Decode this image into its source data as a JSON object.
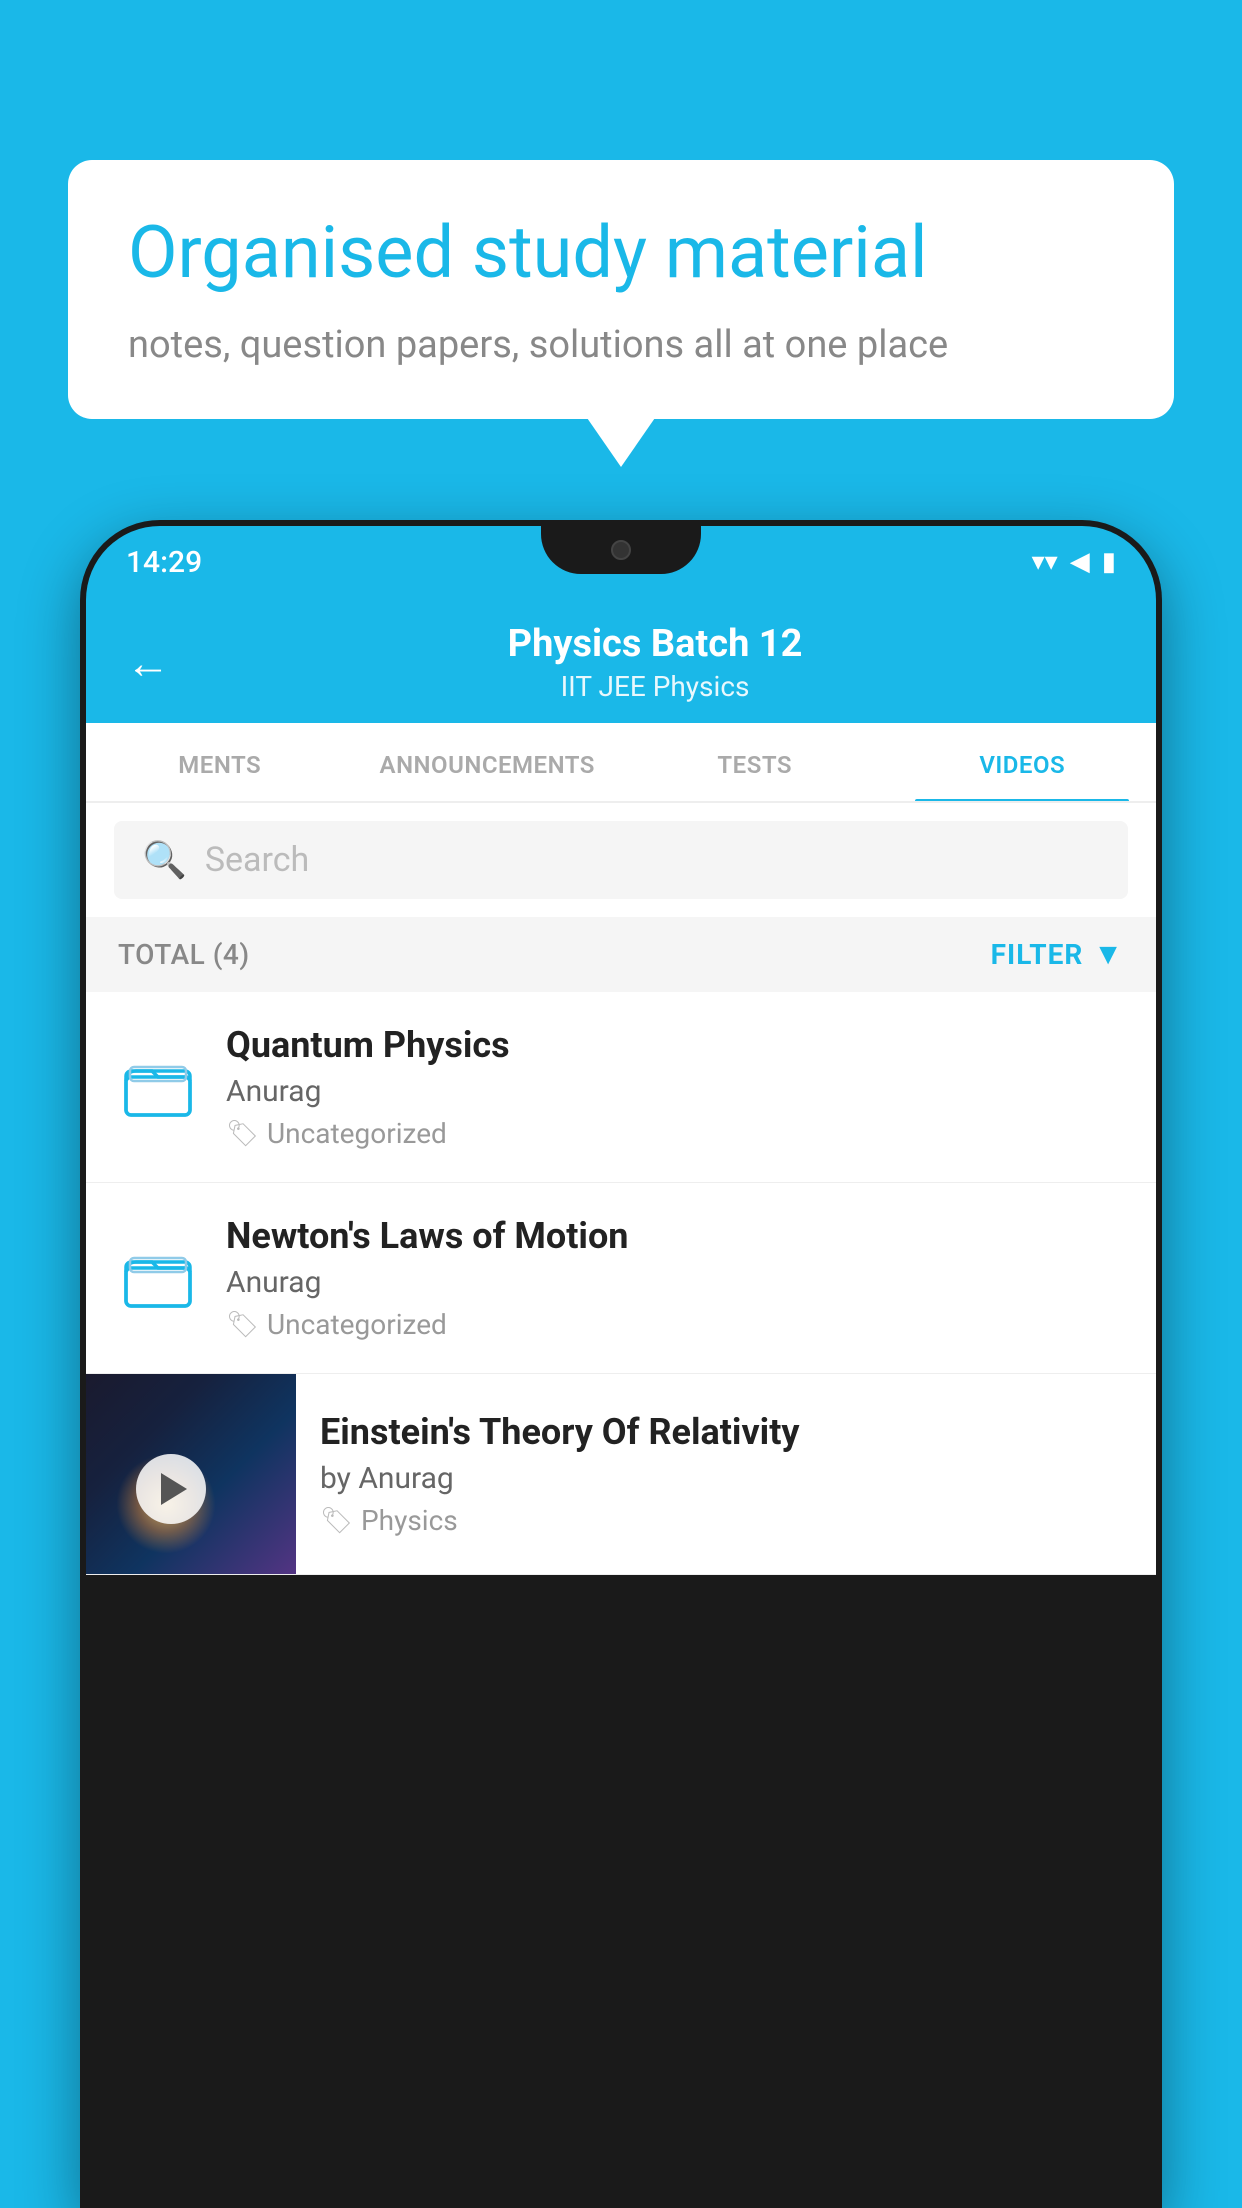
{
  "background_color": "#1ab8e8",
  "speech_bubble": {
    "heading": "Organised study material",
    "subtext": "notes, question papers, solutions all at one place"
  },
  "phone": {
    "status_bar": {
      "time": "14:29",
      "wifi_icon": "wifi",
      "signal_icon": "signal",
      "battery_icon": "battery"
    },
    "app_header": {
      "back_label": "←",
      "title": "Physics Batch 12",
      "subtitle": "IIT JEE   Physics"
    },
    "tabs": [
      {
        "label": "MENTS",
        "active": false
      },
      {
        "label": "ANNOUNCEMENTS",
        "active": false
      },
      {
        "label": "TESTS",
        "active": false
      },
      {
        "label": "VIDEOS",
        "active": true
      }
    ],
    "search": {
      "placeholder": "Search"
    },
    "filter_bar": {
      "total_label": "TOTAL (4)",
      "filter_label": "FILTER"
    },
    "videos": [
      {
        "id": 1,
        "title": "Quantum Physics",
        "author": "Anurag",
        "tag": "Uncategorized",
        "has_thumbnail": false
      },
      {
        "id": 2,
        "title": "Newton's Laws of Motion",
        "author": "Anurag",
        "tag": "Uncategorized",
        "has_thumbnail": false
      },
      {
        "id": 3,
        "title": "Einstein's Theory Of Relativity",
        "author": "by Anurag",
        "tag": "Physics",
        "has_thumbnail": true
      }
    ]
  }
}
